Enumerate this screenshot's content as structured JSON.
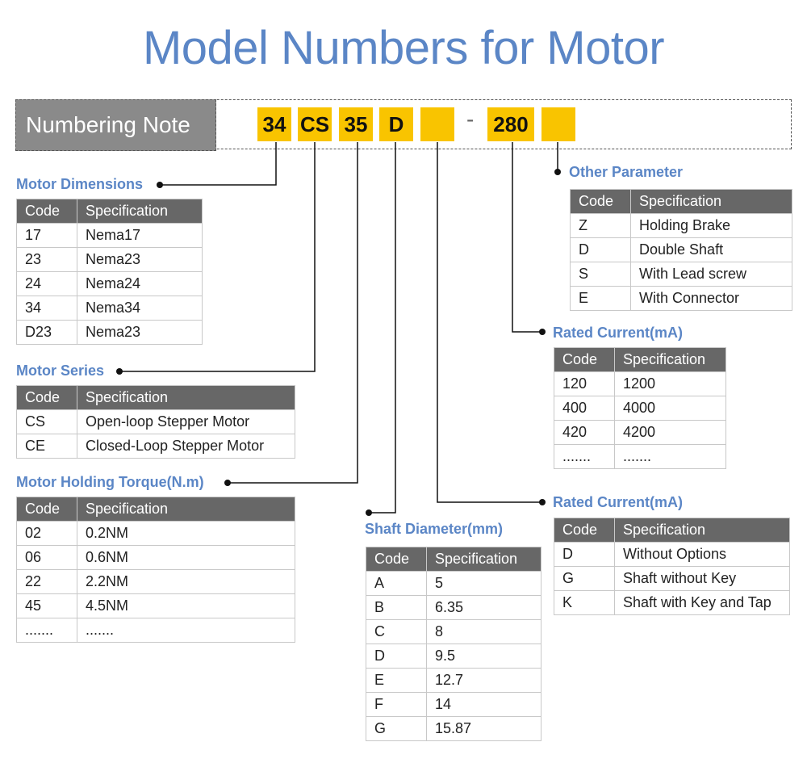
{
  "title": "Model Numbers for Motor",
  "numbering": {
    "label": "Numbering Note",
    "segments": [
      "34",
      "CS",
      "35",
      "D",
      "",
      "280",
      ""
    ],
    "separator": "-"
  },
  "colors": {
    "accent": "#5b86c6",
    "highlight": "#f9c400",
    "header": "#676767"
  },
  "headers": {
    "code": "Code",
    "spec": "Specification"
  },
  "sections": {
    "dimensions": {
      "title": "Motor Dimensions",
      "rows": [
        [
          "17",
          "Nema17"
        ],
        [
          "23",
          "Nema23"
        ],
        [
          "24",
          "Nema24"
        ],
        [
          "34",
          "Nema34"
        ],
        [
          "D23",
          "Nema23"
        ]
      ]
    },
    "series": {
      "title": "Motor Series",
      "rows": [
        [
          "CS",
          "Open-loop Stepper Motor"
        ],
        [
          "CE",
          "Closed-Loop Stepper Motor"
        ]
      ]
    },
    "torque": {
      "title": "Motor Holding Torque(N.m)",
      "rows": [
        [
          "02",
          "0.2NM"
        ],
        [
          "06",
          "0.6NM"
        ],
        [
          "22",
          "2.2NM"
        ],
        [
          "45",
          "4.5NM"
        ],
        [
          ".......",
          "......."
        ]
      ]
    },
    "shaft": {
      "title": "Shaft Diameter(mm)",
      "rows": [
        [
          "A",
          "5"
        ],
        [
          "B",
          "6.35"
        ],
        [
          "C",
          "8"
        ],
        [
          "D",
          "9.5"
        ],
        [
          "E",
          "12.7"
        ],
        [
          "F",
          "14"
        ],
        [
          "G",
          "15.87"
        ]
      ]
    },
    "other": {
      "title": "Other Parameter",
      "rows": [
        [
          "Z",
          "Holding Brake"
        ],
        [
          "D",
          "Double Shaft"
        ],
        [
          "S",
          "With Lead screw"
        ],
        [
          "E",
          "With Connector"
        ]
      ]
    },
    "current": {
      "title": "Rated Current(mA)",
      "rows": [
        [
          "120",
          "1200"
        ],
        [
          "400",
          "4000"
        ],
        [
          "420",
          "4200"
        ],
        [
          ".......",
          "......."
        ]
      ]
    },
    "shaft_option": {
      "title": "Rated Current(mA)",
      "rows": [
        [
          "D",
          "Without Options"
        ],
        [
          "G",
          "Shaft without Key"
        ],
        [
          "K",
          "Shaft with Key and Tap"
        ]
      ]
    }
  }
}
